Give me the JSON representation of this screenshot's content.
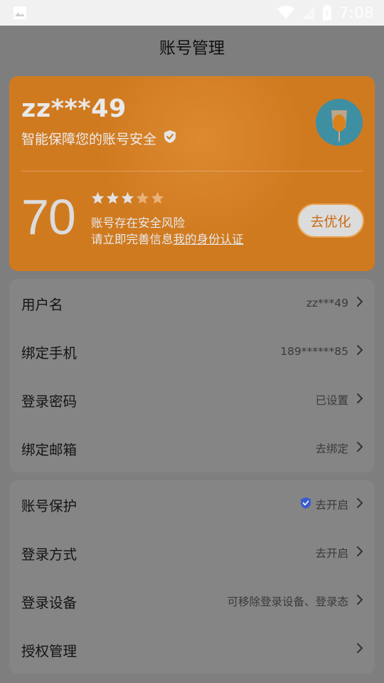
{
  "status_bar": {
    "time": "7:08",
    "icons": [
      "image-icon",
      "wifi-icon",
      "signal-icon",
      "battery-icon"
    ]
  },
  "header": {
    "title": "账号管理"
  },
  "security_card": {
    "username": "zz***49",
    "protect_text": "智能保障您的账号安全",
    "score": "70",
    "stars_filled": 3,
    "stars_total": 5,
    "risk_text": "账号存在安全风险",
    "advice_text": "请立即完善信息",
    "advice_link": "我的身份认证",
    "optimize_label": "去优化",
    "colors": {
      "card": "#d07a20",
      "button_text": "#c86a14"
    }
  },
  "account_list": [
    {
      "label": "用户名",
      "value": "zz***49"
    },
    {
      "label": "绑定手机",
      "value": "189******85"
    },
    {
      "label": "登录密码",
      "value": "已设置"
    },
    {
      "label": "绑定邮箱",
      "value": "去绑定"
    }
  ],
  "security_list": [
    {
      "label": "账号保护",
      "value": "去开启",
      "icon": "shield-icon",
      "icon_color": "#3b5bd0"
    },
    {
      "label": "登录方式",
      "value": "去开启"
    },
    {
      "label": "登录设备",
      "value": "可移除登录设备、登录态"
    },
    {
      "label": "授权管理",
      "value": ""
    }
  ]
}
